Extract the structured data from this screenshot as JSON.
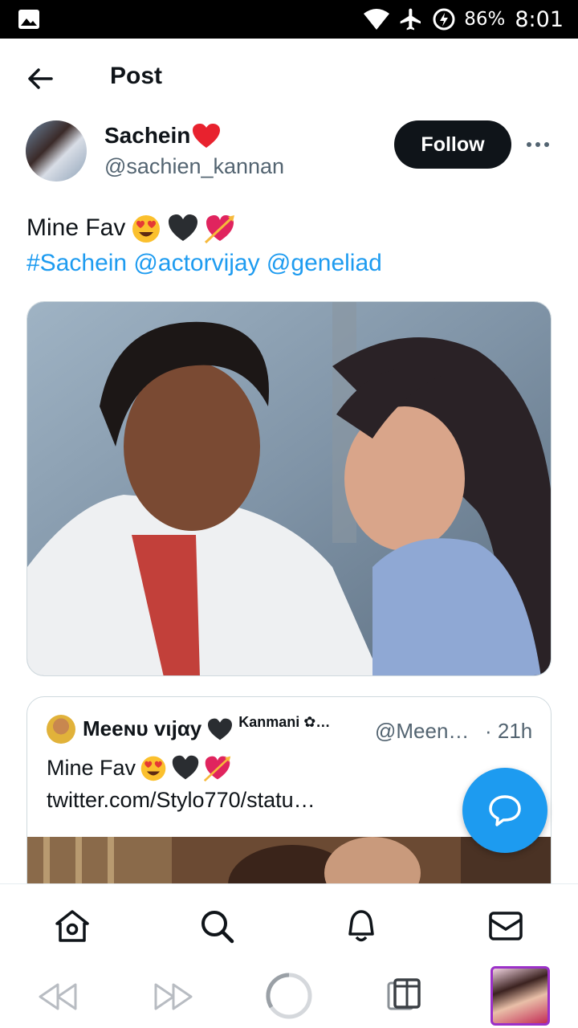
{
  "status_bar": {
    "battery": "86%",
    "time": "8:01",
    "icons": [
      "gallery-icon",
      "wifi-icon",
      "airplane-icon",
      "battery-saver-icon"
    ]
  },
  "header": {
    "back_icon": "arrow-left-icon",
    "title": "Post"
  },
  "post": {
    "author_name": "Sachein",
    "author_handle": "@sachien_kannan",
    "follow_label": "Follow",
    "more_icon": "more-horizontal-icon",
    "text": "Mine Fav",
    "tags": "#Sachein @actorvijay @geneliad",
    "media_icon": "photo"
  },
  "quote": {
    "author_name": "Meeɴυ vιjαy",
    "author_suffix": "Kanmani ✿…",
    "handle": "@Meen…",
    "time": "· 21h",
    "text": "Mine Fav",
    "link": "twitter.com/Stylo770/statu…"
  },
  "fab": {
    "icon": "compose-reply-icon"
  },
  "bottom_nav": [
    "home-icon",
    "search-icon",
    "notifications-icon",
    "messages-icon"
  ],
  "system_nav": [
    "rewind-icon",
    "fast-forward-icon",
    "home-circle-icon",
    "recent-apps-icon",
    "app-thumbnail"
  ],
  "colors": {
    "link": "#1d9bf0",
    "text": "#0f1419",
    "secondary": "#536471",
    "fab": "#1d9bf0"
  }
}
